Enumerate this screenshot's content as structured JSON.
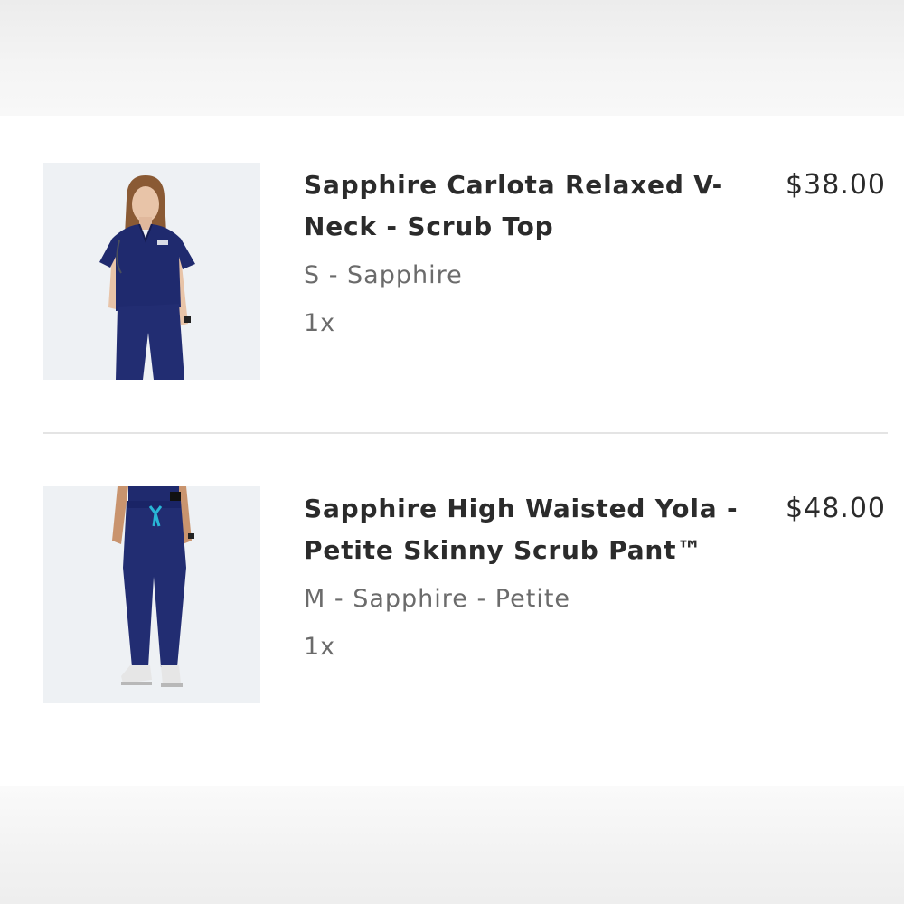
{
  "cart": {
    "items": [
      {
        "name": "Sapphire Carlota Relaxed V-Neck - Scrub Top",
        "variant": "S - Sapphire",
        "quantity": "1x",
        "price": "$38.00",
        "image_label": "product-photo-scrub-top"
      },
      {
        "name": "Sapphire High Waisted Yola - Petite Skinny Scrub Pant™",
        "variant": "M - Sapphire - Petite",
        "quantity": "1x",
        "price": "$48.00",
        "image_label": "product-photo-scrub-pant"
      }
    ]
  },
  "colors": {
    "sapphire": "#1f2a6e",
    "text_primary": "#2b2b2b",
    "text_secondary": "#6b6b6b",
    "divider": "#e4e4e4"
  }
}
